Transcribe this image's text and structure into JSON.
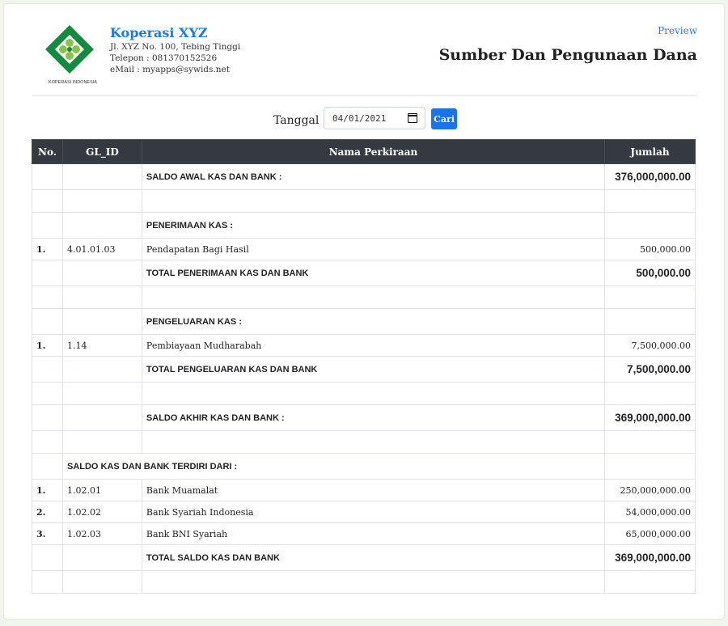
{
  "company": {
    "name": "Koperasi XYZ",
    "address": "Jl. XYZ No. 100, Tebing Tinggi",
    "phone": "Telepon : 081370152526",
    "email": "eMail : myapps@sywids.net",
    "logo_text": "KOPERASI INDONESIA"
  },
  "header": {
    "preview_link": "Preview",
    "title": "Sumber Dan Pengunaan Dana"
  },
  "filter": {
    "label": "Tanggal",
    "date_value": "04/01/2021",
    "search_button": "Cari"
  },
  "table": {
    "columns": [
      "No.",
      "GL_ID",
      "Nama Perkiraan",
      "Jumlah"
    ],
    "saldo_awal": {
      "label": "SALDO AWAL KAS DAN BANK :",
      "amount": "376,000,000.00"
    },
    "penerimaan": {
      "heading": "PENERIMAAN KAS :",
      "items": [
        {
          "no": "1.",
          "gl_id": "4.01.01.03",
          "name": "Pendapatan Bagi Hasil",
          "amount": "500,000.00"
        }
      ],
      "total_label": "TOTAL PENERIMAAN KAS DAN BANK",
      "total_amount": "500,000.00"
    },
    "pengeluaran": {
      "heading": "PENGELUARAN KAS :",
      "items": [
        {
          "no": "1.",
          "gl_id": "1.14",
          "name": "Pembiayaan Mudharabah",
          "amount": "7,500,000.00"
        }
      ],
      "total_label": "TOTAL PENGELUARAN KAS DAN BANK",
      "total_amount": "7,500,000.00"
    },
    "saldo_akhir": {
      "label": "SALDO AKHIR KAS DAN BANK :",
      "amount": "369,000,000.00"
    },
    "rincian": {
      "heading": "SALDO KAS DAN BANK TERDIRI DARI :",
      "items": [
        {
          "no": "1.",
          "gl_id": "1.02.01",
          "name": "Bank Muamalat",
          "amount": "250,000,000.00"
        },
        {
          "no": "2.",
          "gl_id": "1.02.02",
          "name": "Bank Syariah Indonesia",
          "amount": "54,000,000.00"
        },
        {
          "no": "3.",
          "gl_id": "1.02.03",
          "name": "Bank BNI Syariah",
          "amount": "65,000,000.00"
        }
      ],
      "total_label": "TOTAL SALDO KAS DAN BANK",
      "total_amount": "369,000,000.00"
    }
  },
  "colors": {
    "brand_blue": "#1f7ae0",
    "negative_red": "#d32f2f",
    "table_header": "#343a40",
    "logo_green": "#138a3f"
  },
  "icons": {
    "logo": "koperasi-logo-icon",
    "calendar": "calendar-icon"
  }
}
